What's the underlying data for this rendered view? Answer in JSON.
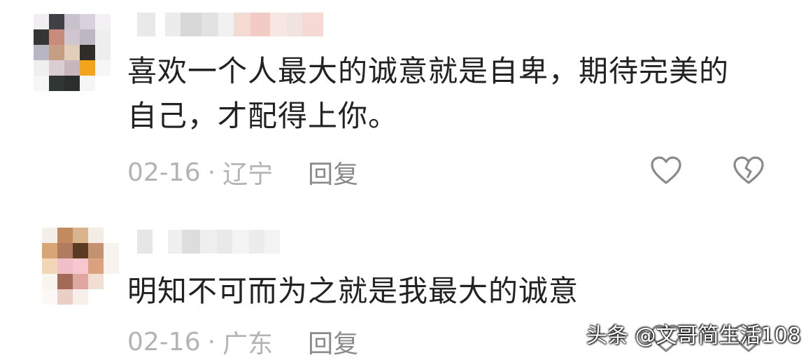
{
  "comments": [
    {
      "text": "喜欢一个人最大的诚意就是自卑，期待完美的\n自己，才配得上你。",
      "date": "02-16",
      "location": "辽宁",
      "reply_label": "回复",
      "like_icon": "heart-outline-icon",
      "dislike_icon": "broken-heart-icon"
    },
    {
      "text": "明知不可而为之就是我最大的诚意",
      "date": "02-16",
      "location": "广东",
      "reply_label": "回复",
      "like_icon": "heart-outline-icon",
      "dislike_icon": "broken-heart-icon"
    }
  ],
  "separator": "·",
  "watermark": "头条 @文哥简生活108",
  "colors": {
    "text": "#222222",
    "meta": "#b3b3b3",
    "icon": "#8a8a8a"
  }
}
